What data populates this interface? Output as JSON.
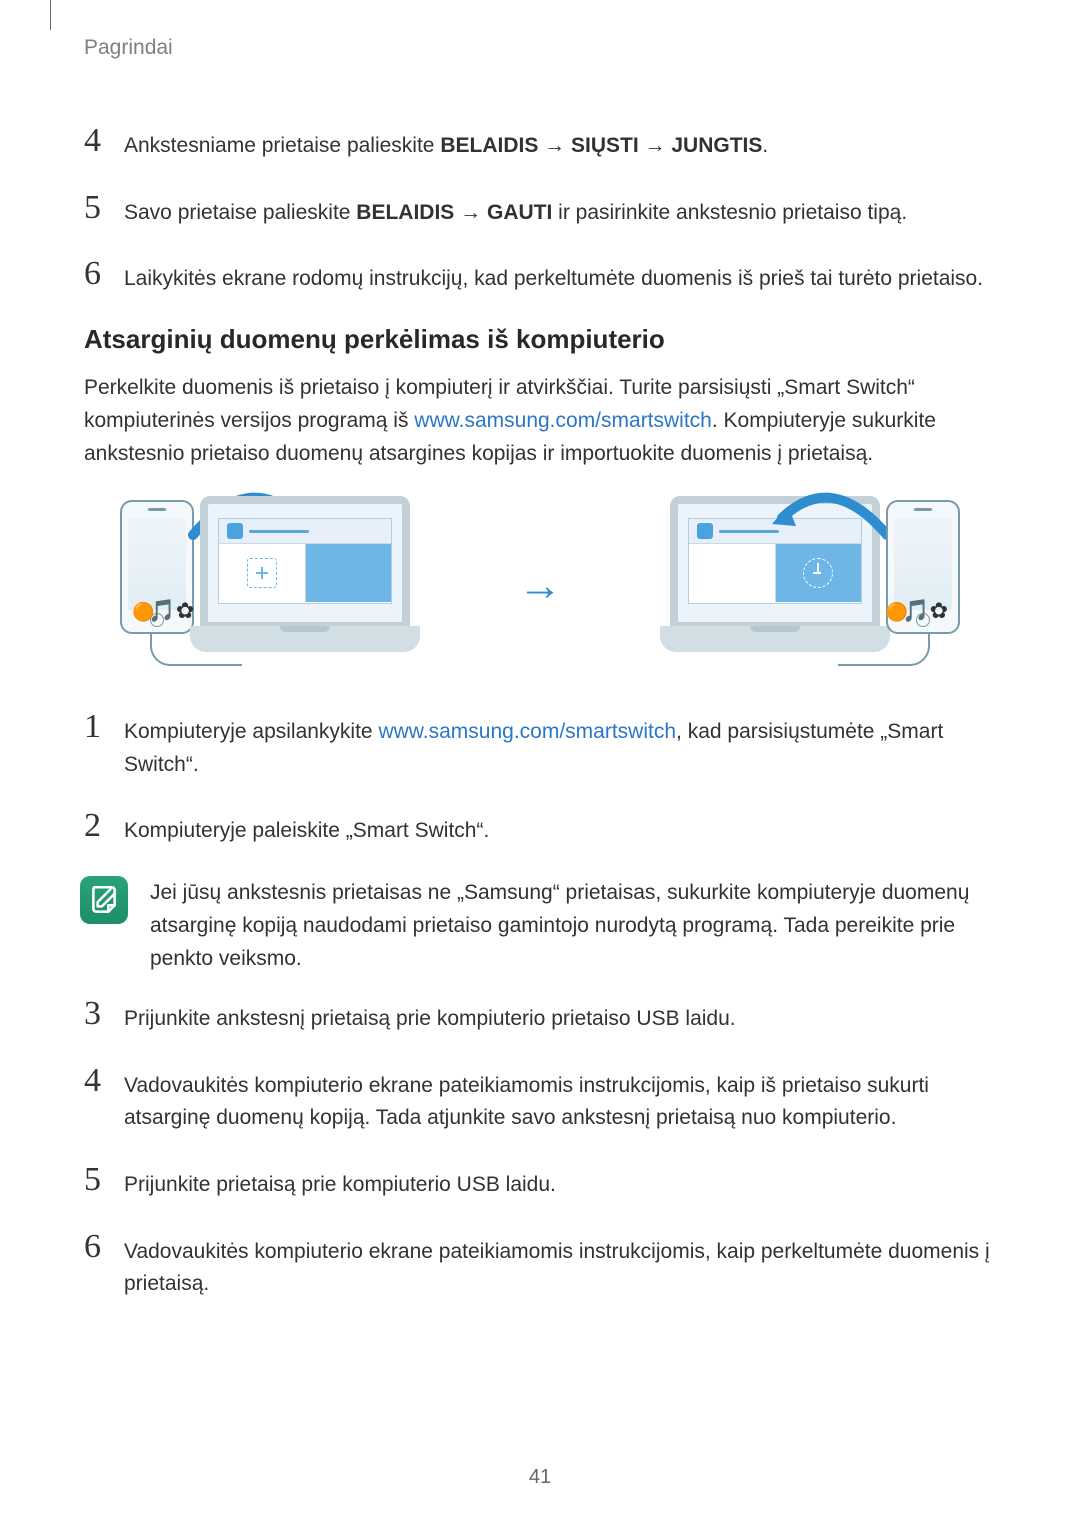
{
  "header": {
    "section": "Pagrindai"
  },
  "listA": {
    "i4": {
      "a": "Ankstesniame prietaise palieskite ",
      "b1": "BELAIDIS",
      "ar1": " → ",
      "b2": "SIŲSTI",
      "ar2": " → ",
      "b3": "JUNGTIS",
      "end": "."
    },
    "i5": {
      "a": "Savo prietaise palieskite ",
      "b1": "BELAIDIS",
      "ar1": " → ",
      "b2": "GAUTI",
      "end": " ir pasirinkite ankstesnio prietaiso tipą."
    },
    "i6": "Laikykitės ekrane rodomų instrukcijų, kad perkeltumėte duomenis iš prieš tai turėto prietaiso."
  },
  "h2": "Atsarginių duomenų perkėlimas iš kompiuterio",
  "intro": {
    "a": "Perkelkite duomenis iš prietaiso į kompiuterį ir atvirkščiai. Turite parsisiųsti „Smart Switch“ kompiuterinės versijos programą iš ",
    "link": "www.samsung.com/smartswitch",
    "b": ". Kompiuteryje sukurkite ankstesnio prietaiso duomenų atsargines kopijas ir importuokite duomenis į prietaisą."
  },
  "listB": {
    "i1": {
      "a": "Kompiuteryje apsilankykite ",
      "link": "www.samsung.com/smartswitch",
      "b": ", kad parsisiųstumėte „Smart Switch“."
    },
    "i2": "Kompiuteryje paleiskite „Smart Switch“.",
    "note": "Jei jūsų ankstesnis prietaisas ne „Samsung“ prietaisas, sukurkite kompiuteryje duomenų atsarginę kopiją naudodami prietaiso gamintojo nurodytą programą. Tada pereikite prie penkto veiksmo.",
    "i3": "Prijunkite ankstesnį prietaisą prie kompiuterio prietaiso USB laidu.",
    "i4": "Vadovaukitės kompiuterio ekrane pateikiamomis instrukcijomis, kaip iš prietaiso sukurti atsarginę duomenų kopiją. Tada atjunkite savo ankstesnį prietaisą nuo kompiuterio.",
    "i5": "Prijunkite prietaisą prie kompiuterio USB laidu.",
    "i6": "Vadovaukitės kompiuterio ekrane pateikiamomis instrukcijomis, kaip perkeltumėte duomenis į prietaisą."
  },
  "nums": {
    "n1": "1",
    "n2": "2",
    "n3": "3",
    "n4": "4",
    "n5": "5",
    "n6": "6"
  },
  "pageNumber": "41"
}
